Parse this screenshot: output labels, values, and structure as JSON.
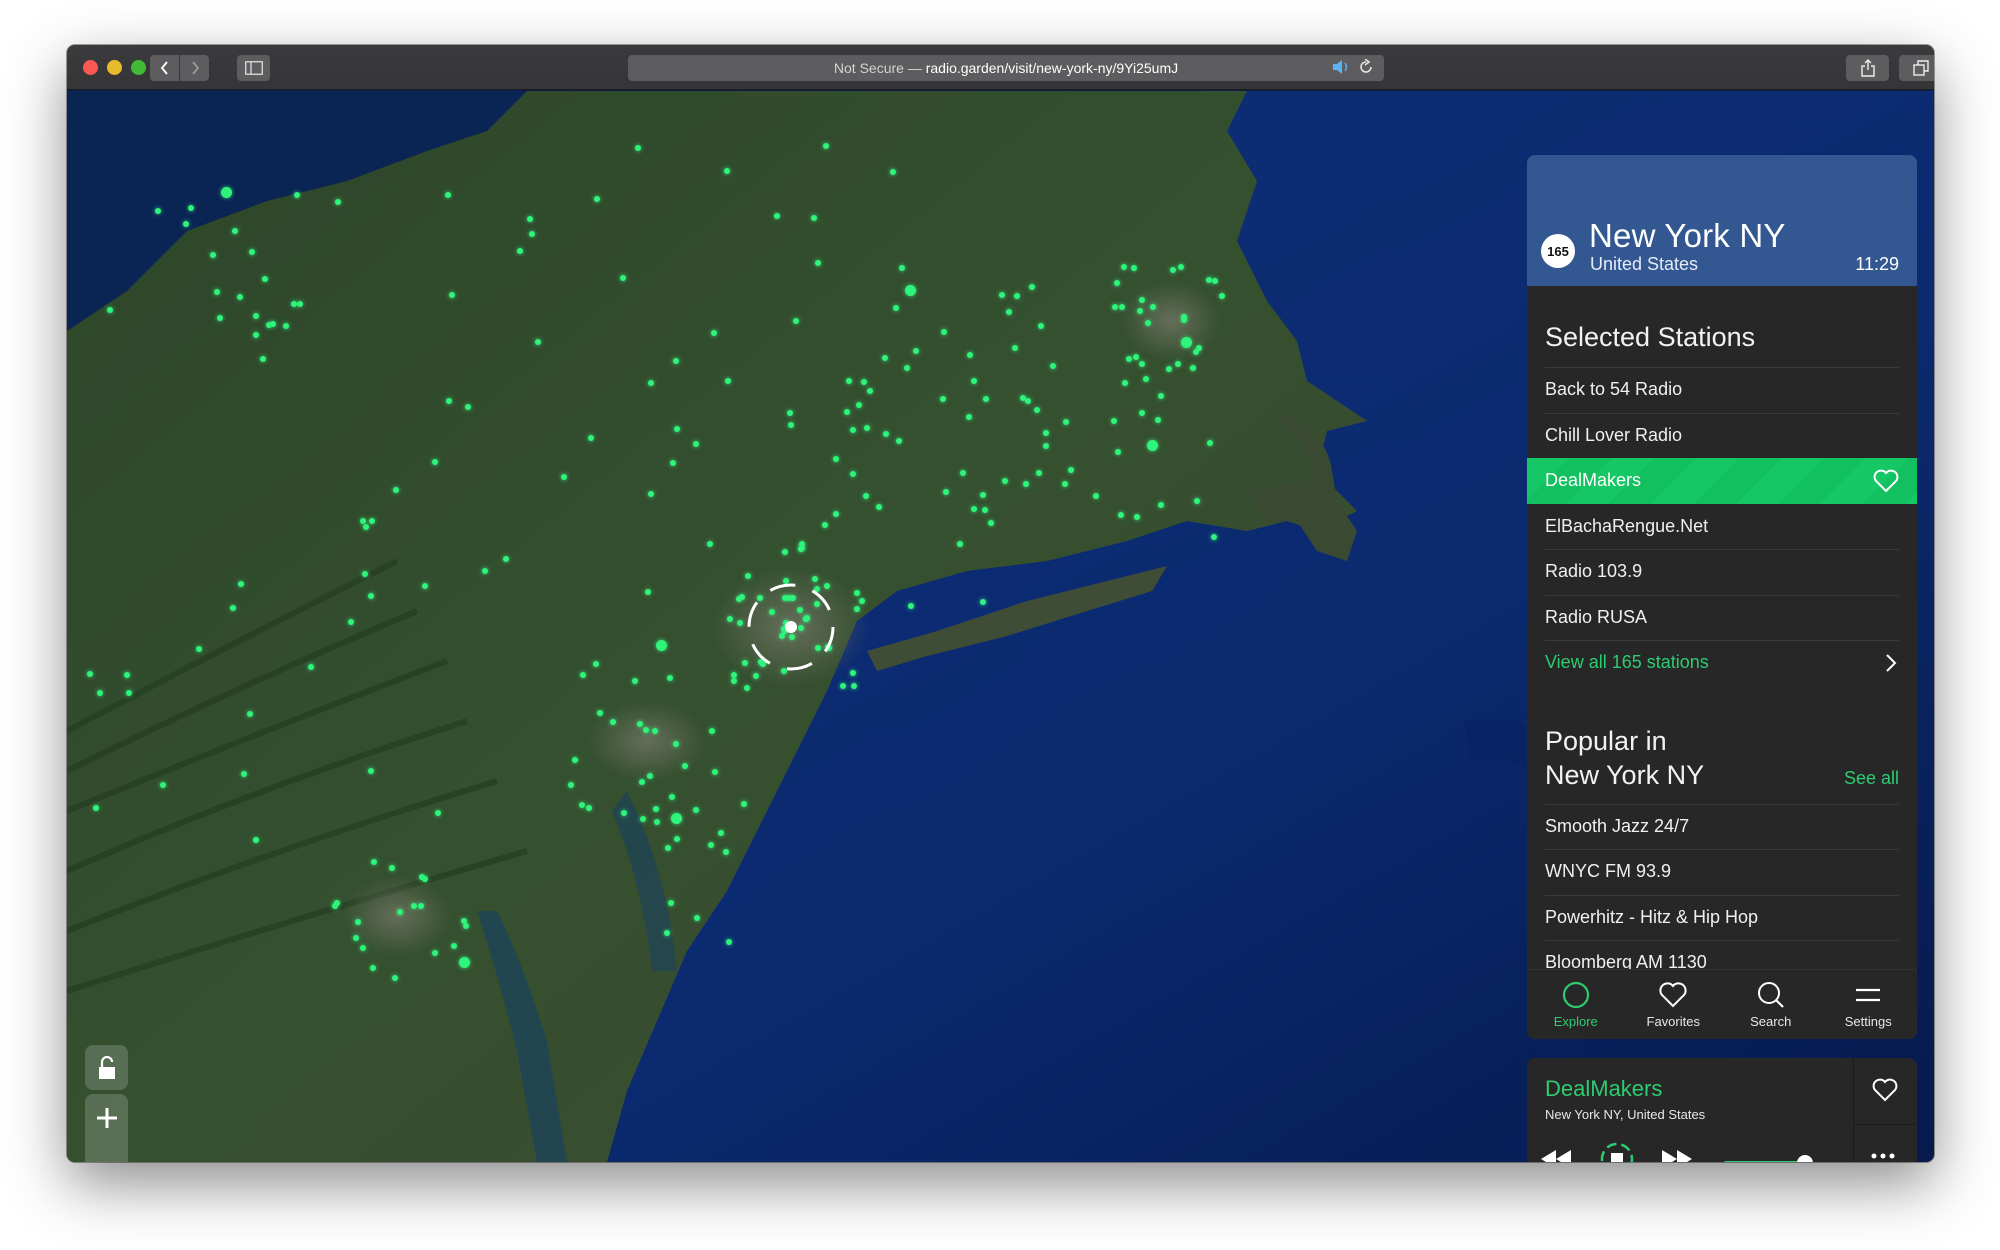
{
  "browser": {
    "address_prefix": "Not Secure —",
    "address_host": "radio.garden",
    "address_path": "/visit/new-york-ny/9Yi25umJ",
    "icons": [
      "back-icon",
      "forward-icon",
      "sidebar-icon",
      "speaker-icon",
      "reload-icon",
      "share-icon",
      "tabs-icon",
      "new-tab-icon"
    ]
  },
  "map": {
    "controls": {
      "lock_icon": "unlock-icon",
      "zoom_in": "+",
      "zoom_out": "−"
    },
    "accent": "#2cf57a"
  },
  "place": {
    "station_count": "165",
    "city": "New York NY",
    "country": "United States",
    "local_time": "11:29"
  },
  "selected": {
    "title": "Selected Stations",
    "stations": [
      {
        "name": "Back to 54 Radio",
        "active": false
      },
      {
        "name": "Chill Lover Radio",
        "active": false
      },
      {
        "name": "DealMakers",
        "active": true
      },
      {
        "name": "ElBachaRengue.Net",
        "active": false
      },
      {
        "name": "Radio 103.9",
        "active": false
      },
      {
        "name": "Radio RUSA",
        "active": false
      }
    ],
    "view_all": "View all 165 stations"
  },
  "popular": {
    "title_line1": "Popular in",
    "title_line2": "New York NY",
    "see_all": "See all",
    "stations": [
      "Smooth Jazz 24/7",
      "WNYC FM 93.9",
      "Powerhitz - Hitz & Hip Hop",
      "Bloomberg AM 1130"
    ]
  },
  "tabs": [
    {
      "label": "Explore",
      "icon": "explore-icon",
      "active": true
    },
    {
      "label": "Favorites",
      "icon": "heart-icon",
      "active": false
    },
    {
      "label": "Search",
      "icon": "search-icon",
      "active": false
    },
    {
      "label": "Settings",
      "icon": "menu-icon",
      "active": false
    }
  ],
  "player": {
    "station": "DealMakers",
    "location": "New York NY, United States",
    "volume": 0.75,
    "state": "playing",
    "accent": "#2ecc71"
  }
}
